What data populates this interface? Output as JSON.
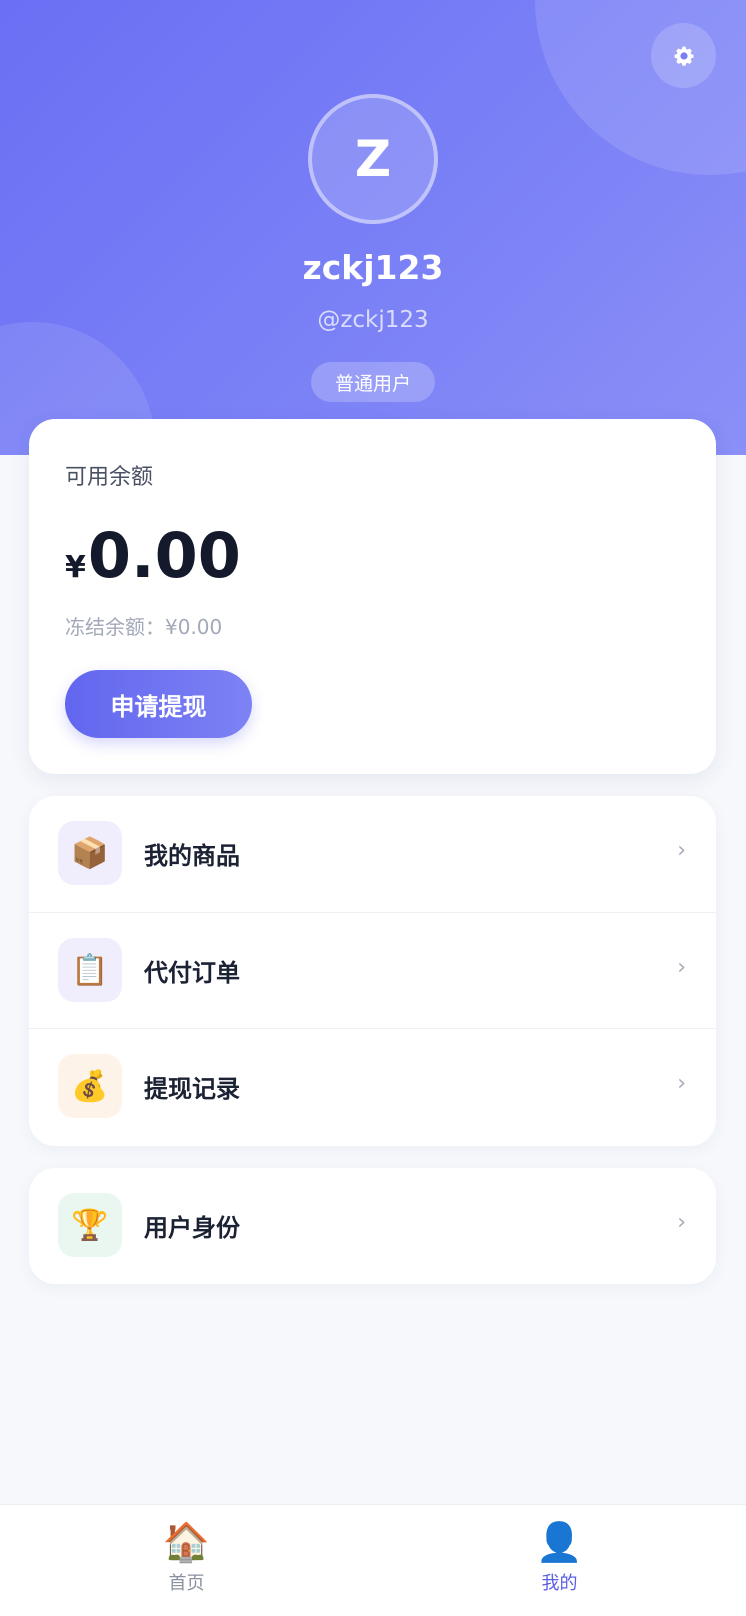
{
  "profile": {
    "avatar_initial": "Z",
    "username": "zckj123",
    "handle": "@zckj123",
    "role": "普通用户",
    "settings_icon": "⚙"
  },
  "balance": {
    "label": "可用余额",
    "currency": "¥",
    "amount": "0.00",
    "frozen": "冻结余额：¥0.00",
    "withdraw_button": "申请提现"
  },
  "menu": [
    {
      "label": "我的商品",
      "icon": "📦",
      "icon_name": "package-icon",
      "icon_bg": "#f0eefc"
    },
    {
      "label": "代付订单",
      "icon": "📋",
      "icon_name": "clipboard-icon",
      "icon_bg": "#f0eefc"
    },
    {
      "label": "提现记录",
      "icon": "💰",
      "icon_name": "money-bag-icon",
      "icon_bg": "#fdf3e8"
    }
  ],
  "menu2": [
    {
      "label": "用户身份",
      "icon": "🏆",
      "icon_name": "trophy-icon",
      "icon_bg": "#eaf7f1"
    }
  ],
  "chevron": "›",
  "tabbar": {
    "home": {
      "icon": "🏠",
      "label": "首页"
    },
    "me": {
      "icon": "👤",
      "label": "我的"
    }
  },
  "colors": {
    "accent": "#6266ef",
    "active_tab": "#5b5fe0"
  }
}
